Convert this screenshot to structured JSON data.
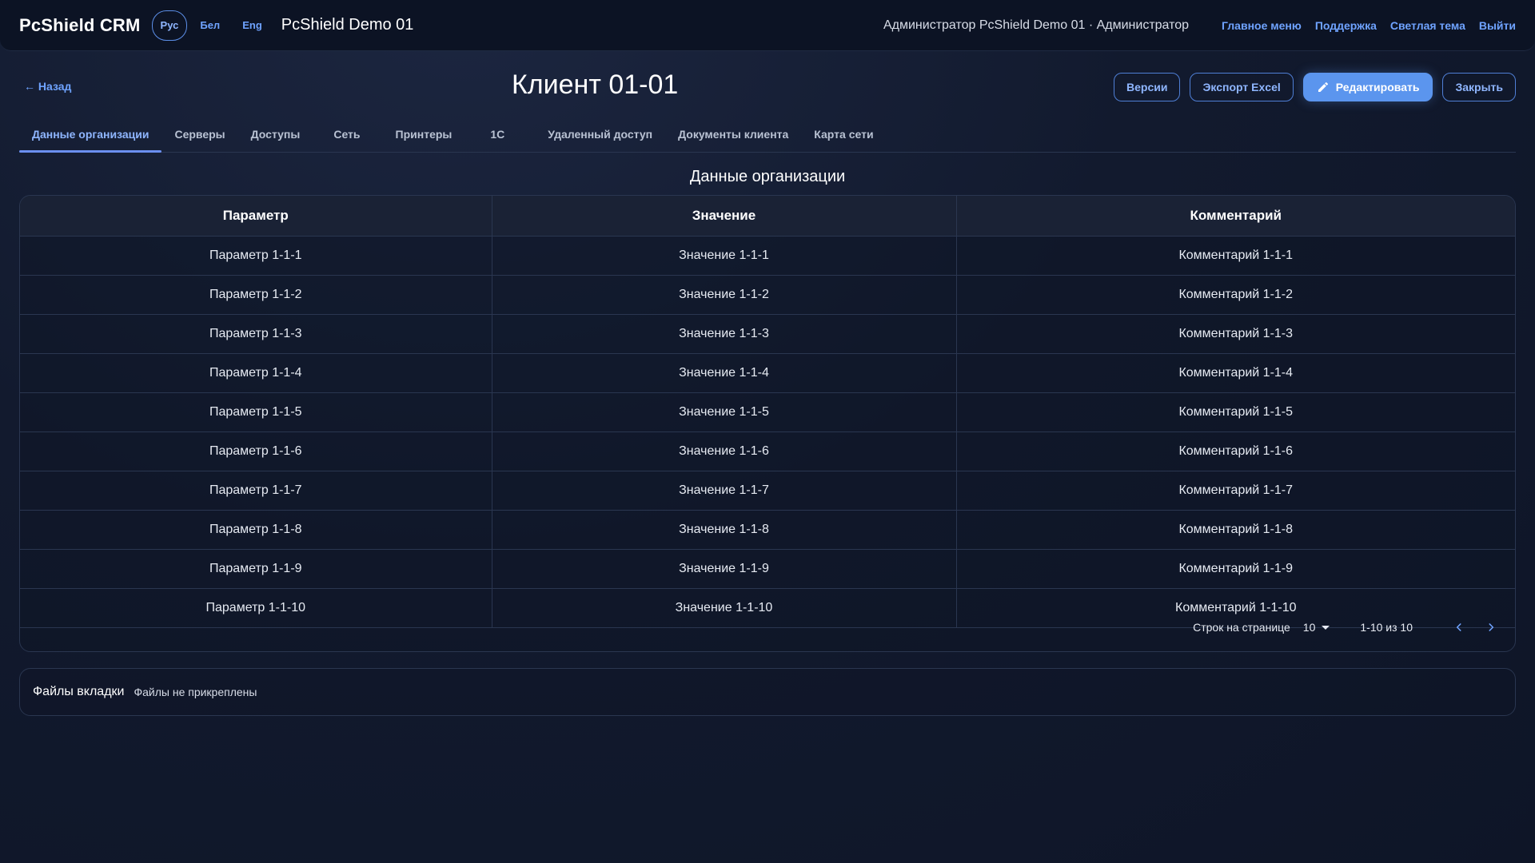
{
  "app": {
    "brand": "PcShield CRM",
    "languages": [
      {
        "label": "Рус",
        "active": true
      },
      {
        "label": "Бел",
        "active": false
      },
      {
        "label": "Eng",
        "active": false
      }
    ],
    "organization": "PcShield Demo 01",
    "user": "Администратор PcShield Demo 01 · Администратор",
    "links": [
      "Главное меню",
      "Поддержка",
      "Светлая тема",
      "Выйти"
    ]
  },
  "page": {
    "back_label": "← Назад",
    "title": "Клиент 01-01",
    "actions": {
      "versions": "Версии",
      "export": "Экспорт Excel",
      "edit": "Редактировать",
      "close": "Закрыть"
    },
    "tabs": [
      {
        "label": "Данные организации",
        "active": true
      },
      {
        "label": "Серверы",
        "active": false
      },
      {
        "label": "Доступы",
        "active": false
      },
      {
        "label": "Сеть",
        "active": false
      },
      {
        "label": "Принтеры",
        "active": false
      },
      {
        "label": "1С",
        "active": false
      },
      {
        "label": "Удаленный доступ",
        "active": false
      },
      {
        "label": "Документы клиента",
        "active": false
      },
      {
        "label": "Карта сети",
        "active": false
      }
    ],
    "section_title": "Данные организации"
  },
  "table": {
    "columns": [
      "Параметр",
      "Значение",
      "Комментарий"
    ],
    "rows": [
      [
        "Параметр 1-1-1",
        "Значение 1-1-1",
        "Комментарий 1-1-1"
      ],
      [
        "Параметр 1-1-2",
        "Значение 1-1-2",
        "Комментарий 1-1-2"
      ],
      [
        "Параметр 1-1-3",
        "Значение 1-1-3",
        "Комментарий 1-1-3"
      ],
      [
        "Параметр 1-1-4",
        "Значение 1-1-4",
        "Комментарий 1-1-4"
      ],
      [
        "Параметр 1-1-5",
        "Значение 1-1-5",
        "Комментарий 1-1-5"
      ],
      [
        "Параметр 1-1-6",
        "Значение 1-1-6",
        "Комментарий 1-1-6"
      ],
      [
        "Параметр 1-1-7",
        "Значение 1-1-7",
        "Комментарий 1-1-7"
      ],
      [
        "Параметр 1-1-8",
        "Значение 1-1-8",
        "Комментарий 1-1-8"
      ],
      [
        "Параметр 1-1-9",
        "Значение 1-1-9",
        "Комментарий 1-1-9"
      ],
      [
        "Параметр 1-1-10",
        "Значение 1-1-10",
        "Комментарий 1-1-10"
      ]
    ],
    "pagination": {
      "rows_per_page_label": "Строк на странице",
      "rows_per_page": "10",
      "range": "1-10 из 10"
    }
  },
  "files": {
    "label": "Файлы вкладки",
    "empty_text": "Файлы не прикреплены"
  },
  "colors": {
    "accent": "#5b95ee",
    "link": "#6fa3ff",
    "background": "#121a2e",
    "border": "#2a3650"
  },
  "icons": [
    "pencil-icon",
    "chevron-left-icon",
    "chevron-right-icon",
    "caret-down-icon"
  ]
}
